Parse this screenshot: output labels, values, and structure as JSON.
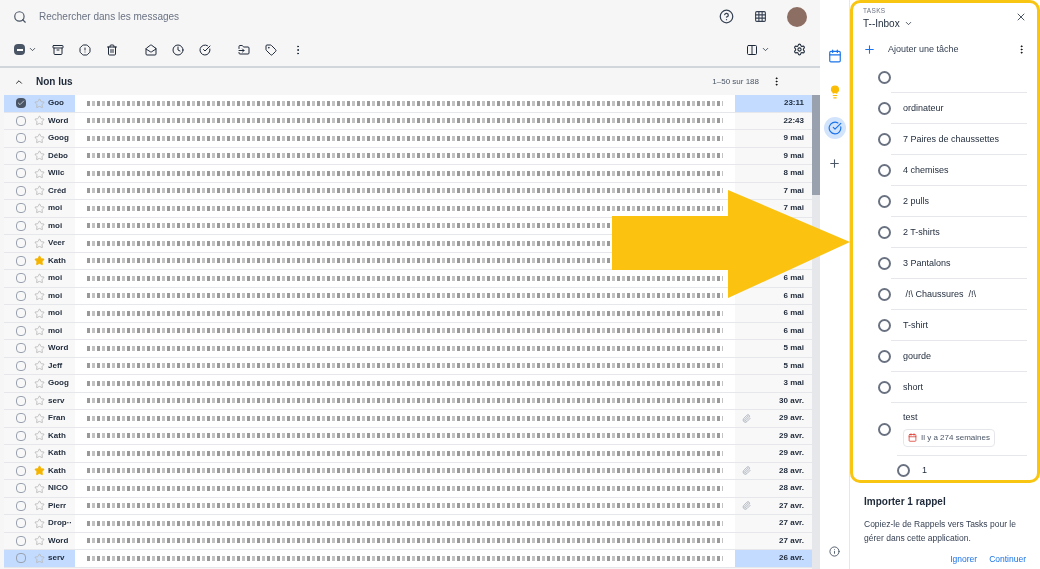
{
  "search": {
    "placeholder": "Rechercher dans les messages"
  },
  "toolbar": {
    "select_indeterminate": true
  },
  "section": {
    "title": "Non lus",
    "expanded": true,
    "count": "1–50 sur 188"
  },
  "emails": [
    {
      "sender": "Goo",
      "date": "23:11",
      "checked": true,
      "selected": true,
      "starred": false,
      "attachment": false
    },
    {
      "sender": "Word",
      "date": "22:43",
      "checked": false,
      "selected": false,
      "starred": false,
      "attachment": false
    },
    {
      "sender": "Goog",
      "date": "9 mai",
      "checked": false,
      "selected": false,
      "starred": false,
      "attachment": false
    },
    {
      "sender": "Débo",
      "date": "9 mai",
      "checked": false,
      "selected": false,
      "starred": false,
      "attachment": false
    },
    {
      "sender": "Wilc",
      "date": "8 mai",
      "checked": false,
      "selected": false,
      "starred": false,
      "attachment": false
    },
    {
      "sender": "Créd",
      "date": "7 mai",
      "checked": false,
      "selected": false,
      "starred": false,
      "attachment": false
    },
    {
      "sender": "moi",
      "date": "7 mai",
      "checked": false,
      "selected": false,
      "starred": false
    },
    {
      "sender": "moi",
      "checked": false,
      "selected": false,
      "starred": false
    },
    {
      "sender": "Veer",
      "checked": false,
      "selected": false,
      "starred": false
    },
    {
      "sender": "Kath",
      "checked": false,
      "selected": false,
      "starred": true
    },
    {
      "sender": "moi",
      "date": "6 mai",
      "checked": false,
      "selected": false,
      "starred": false
    },
    {
      "sender": "moi",
      "date": "6 mai",
      "checked": false,
      "selected": false,
      "starred": false,
      "attachment": false
    },
    {
      "sender": "moi",
      "date": "6 mai",
      "checked": false,
      "selected": false,
      "starred": false,
      "attachment": false
    },
    {
      "sender": "moi",
      "date": "6 mai",
      "checked": false,
      "selected": false,
      "starred": false,
      "attachment": false
    },
    {
      "sender": "Word",
      "date": "5 mai",
      "checked": false,
      "selected": false,
      "starred": false,
      "attachment": false
    },
    {
      "sender": "Jeff",
      "date": "5 mai",
      "checked": false,
      "selected": false,
      "starred": false,
      "attachment": false
    },
    {
      "sender": "Goog",
      "date": "3 mai",
      "checked": false,
      "selected": false,
      "starred": false,
      "attachment": false
    },
    {
      "sender": "serv",
      "date": "30 avr.",
      "checked": false,
      "selected": false,
      "starred": false,
      "attachment": false
    },
    {
      "sender": "Fran",
      "date": "29 avr.",
      "checked": false,
      "selected": false,
      "starred": false,
      "attachment": true
    },
    {
      "sender": "Kath",
      "date": "29 avr.",
      "checked": false,
      "selected": false,
      "starred": false,
      "attachment": false
    },
    {
      "sender": "Kath",
      "date": "29 avr.",
      "checked": false,
      "selected": false,
      "starred": false,
      "attachment": false
    },
    {
      "sender": "Kath",
      "date": "28 avr.",
      "checked": false,
      "selected": false,
      "starred": true,
      "attachment": true
    },
    {
      "sender": "NICO",
      "date": "28 avr.",
      "checked": false,
      "selected": false,
      "starred": false,
      "attachment": false
    },
    {
      "sender": "Pierr",
      "date": "27 avr.",
      "checked": false,
      "selected": false,
      "starred": false,
      "attachment": true
    },
    {
      "sender": "Drop··",
      "date": "27 avr.",
      "checked": false,
      "selected": false,
      "starred": false,
      "attachment": false
    },
    {
      "sender": "Word",
      "date": "27 avr.",
      "checked": false,
      "selected": false,
      "starred": false,
      "attachment": false
    },
    {
      "sender": "serv",
      "date": "26 avr.",
      "checked": false,
      "selected": true,
      "starred": false,
      "attachment": false
    }
  ],
  "side_apps": [
    {
      "kind": "calendar",
      "selected": false
    },
    {
      "kind": "keep",
      "selected": false
    },
    {
      "kind": "tasks",
      "selected": true
    }
  ],
  "tasks_panel": {
    "label": "TASKS",
    "list_name": "T--Inbox",
    "add_label": "Ajouter une tâche",
    "tasks": [
      {
        "completed": false
      },
      {
        "title": "ordinateur",
        "completed": false
      },
      {
        "title": "7 Paires de chaussettes",
        "completed": false
      },
      {
        "title": "4 chemises",
        "completed": false
      },
      {
        "title": "2 pulls",
        "completed": false
      },
      {
        "title": "2 T-shirts",
        "completed": false
      },
      {
        "title": "3 Pantalons",
        "completed": false
      },
      {
        "title": " /!\\ Chaussures  /!\\",
        "completed": false
      },
      {
        "title": "T-shirt",
        "completed": false
      },
      {
        "title": "gourde",
        "completed": false
      },
      {
        "title": "short",
        "completed": false
      },
      {
        "title": "test",
        "completed": false,
        "due": "Il y a 274 semaines",
        "children": [
          {
            "title": "1",
            "completed": false
          }
        ]
      }
    ]
  },
  "import": {
    "title": "Importer 1 rappel",
    "text": "Copiez-le de Rappels vers Tasks pour le gérer dans cette application.",
    "buttons": [
      "Ignorer",
      "Continuer"
    ]
  }
}
